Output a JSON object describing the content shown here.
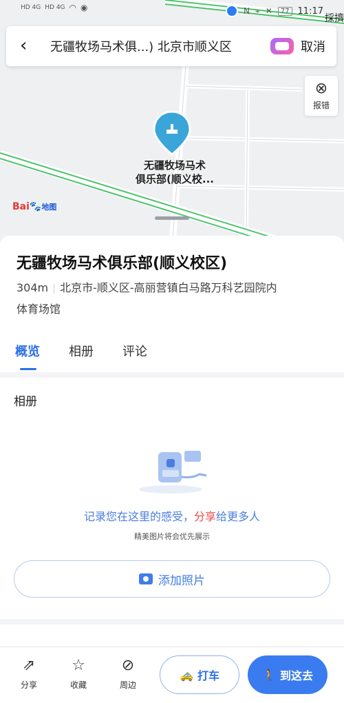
{
  "status_bar": {
    "signal_1": "HD 4G",
    "signal_2": "HD 4G",
    "battery": "77",
    "time": "11:17",
    "extra_text": "採擠"
  },
  "search": {
    "query": "无疆牧场马术俱...) 北京市顺义区",
    "cancel_label": "取消"
  },
  "map": {
    "report_label": "报错",
    "pin_label": "无疆牧场马术\n俱乐部(顺义校...",
    "logo_text": "Bai",
    "logo_du": "du",
    "logo_ditu": "地图"
  },
  "place": {
    "title": "无疆牧场马术俱乐部(顺义校区)",
    "distance": "304m",
    "address": "北京市-顺义区-高丽营镇白马路万科艺园院内",
    "category": "体育场馆"
  },
  "tabs": [
    {
      "label": "概览",
      "active": true
    },
    {
      "label": "相册",
      "active": false
    },
    {
      "label": "评论",
      "active": false
    }
  ],
  "album": {
    "title": "相册",
    "msg_part1": "记录您在这里的感受，",
    "msg_highlight": "分享",
    "msg_part2": "给更多人",
    "sub": "精美图片将会优先展示",
    "add_label": "添加照片"
  },
  "bottom_bar": {
    "share_label": "分享",
    "favorite_label": "收藏",
    "nearby_label": "周边",
    "taxi_label": "打车",
    "go_label": "到这去"
  },
  "colors": {
    "accent": "#2b6fe8",
    "highlight": "#e94a4a",
    "road_green": "#4cc36a"
  }
}
